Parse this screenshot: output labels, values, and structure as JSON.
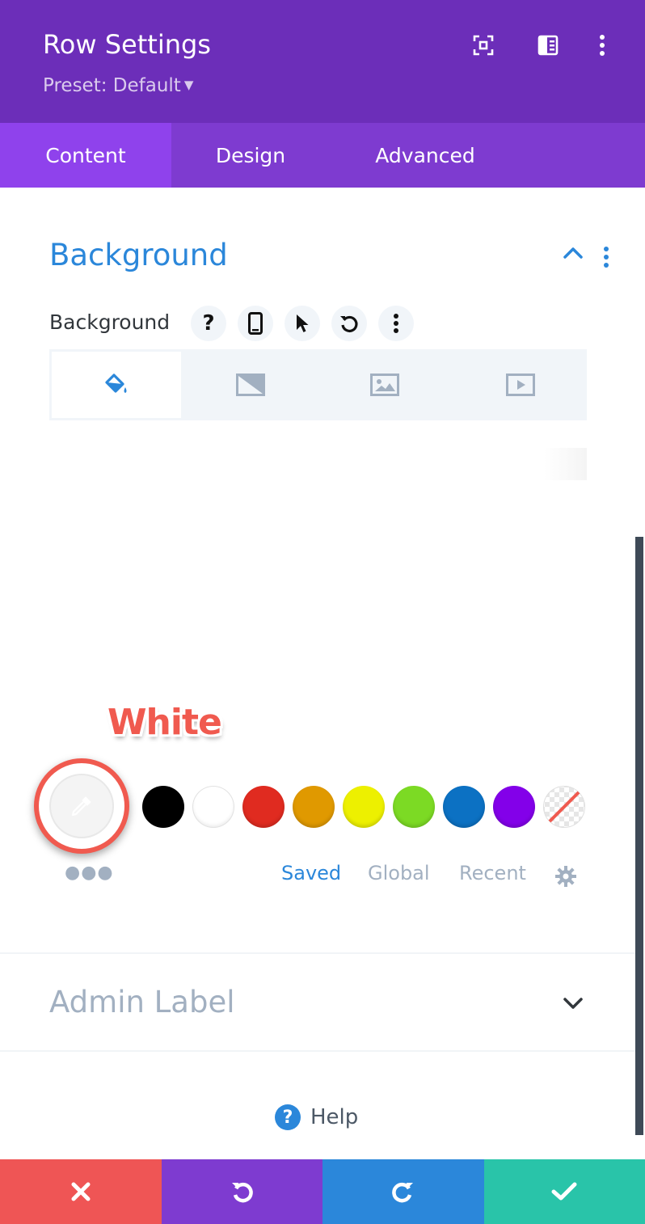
{
  "header": {
    "title": "Row Settings",
    "preset_label": "Preset: Default",
    "icons": [
      "expand-icon",
      "sidebar-icon",
      "more-vertical-icon"
    ],
    "bg_color": "#6c2eb9"
  },
  "tabs": [
    {
      "label": "Content",
      "active": true
    },
    {
      "label": "Design",
      "active": false
    },
    {
      "label": "Advanced",
      "active": false
    }
  ],
  "background_section": {
    "title": "Background",
    "field_label": "Background",
    "field_buttons": [
      "help-icon",
      "mobile-icon",
      "hover-cursor-icon",
      "reset-icon",
      "more-icon"
    ],
    "bg_type_tabs": [
      "paint-bucket-icon",
      "gradient-icon",
      "image-icon",
      "video-icon"
    ],
    "active_type": "paint-bucket-icon"
  },
  "annotation": {
    "text": "White",
    "color": "#f05a4f"
  },
  "swatches": [
    {
      "name": "black",
      "color": "#000000"
    },
    {
      "name": "white",
      "color": "#ffffff"
    },
    {
      "name": "red",
      "color": "#e02b20"
    },
    {
      "name": "orange",
      "color": "#e09900"
    },
    {
      "name": "yellow",
      "color": "#edf000"
    },
    {
      "name": "green",
      "color": "#7cda24"
    },
    {
      "name": "blue",
      "color": "#0c71c3"
    },
    {
      "name": "purple",
      "color": "#8300e9"
    },
    {
      "name": "transparent",
      "color": "transparent"
    }
  ],
  "swatch_tabs": {
    "saved": "Saved",
    "global": "Global",
    "recent": "Recent",
    "active": "saved"
  },
  "admin_section": {
    "title": "Admin Label"
  },
  "help": {
    "label": "Help"
  },
  "footer": {
    "buttons": [
      {
        "name": "discard",
        "icon": "close-icon",
        "color": "#ef5555"
      },
      {
        "name": "undo",
        "icon": "undo-icon",
        "color": "#7e3bd0"
      },
      {
        "name": "redo",
        "icon": "redo-icon",
        "color": "#2b87da"
      },
      {
        "name": "save",
        "icon": "check-icon",
        "color": "#29c4a9"
      }
    ]
  }
}
